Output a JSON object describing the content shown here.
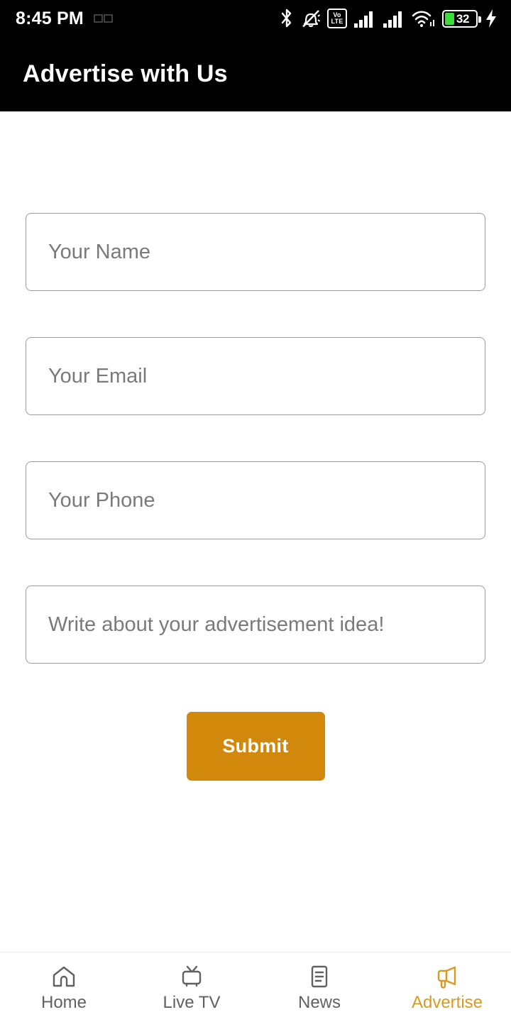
{
  "status_bar": {
    "time": "8:45 PM",
    "icons": [
      {
        "name": "notification-dot-icon",
        "label": ""
      },
      {
        "name": "bluetooth-icon",
        "label": ""
      },
      {
        "name": "silent-bell-icon",
        "label": ""
      },
      {
        "name": "volte-icon",
        "label_top": "Vo",
        "label_bottom": "LTE"
      },
      {
        "name": "signal-bars-sim1-icon",
        "label": ""
      },
      {
        "name": "signal-bars-sim2-icon",
        "label": ""
      },
      {
        "name": "wifi-icon",
        "label": ""
      },
      {
        "name": "battery-icon",
        "label": ""
      },
      {
        "name": "charging-bolt-icon",
        "label": ""
      }
    ],
    "battery": {
      "percent_text": "32",
      "percent_value": 32,
      "fill_color": "#3ddc3d"
    }
  },
  "app_bar": {
    "title": "Advertise with Us"
  },
  "form": {
    "fields": [
      {
        "name": "name-input",
        "placeholder": "Your Name",
        "value": ""
      },
      {
        "name": "email-input",
        "placeholder": "Your Email",
        "value": ""
      },
      {
        "name": "phone-input",
        "placeholder": "Your Phone",
        "value": ""
      },
      {
        "name": "message-input",
        "placeholder": "Write about your advertisement idea!",
        "value": ""
      }
    ],
    "submit_label": "Submit"
  },
  "bottom_nav": {
    "active_index": 3,
    "items": [
      {
        "label": "Home",
        "icon": "home-icon"
      },
      {
        "label": "Live TV",
        "icon": "tv-icon"
      },
      {
        "label": "News",
        "icon": "news-document-icon"
      },
      {
        "label": "Advertise",
        "icon": "megaphone-icon"
      }
    ]
  },
  "colors": {
    "accent": "#d2880b",
    "accent_active_text": "#d89a20",
    "app_bar_bg": "#000000",
    "page_bg": "#ffffff",
    "field_border": "#9b9b9b",
    "placeholder_text": "#7a7a7a",
    "nav_inactive": "#616161"
  }
}
